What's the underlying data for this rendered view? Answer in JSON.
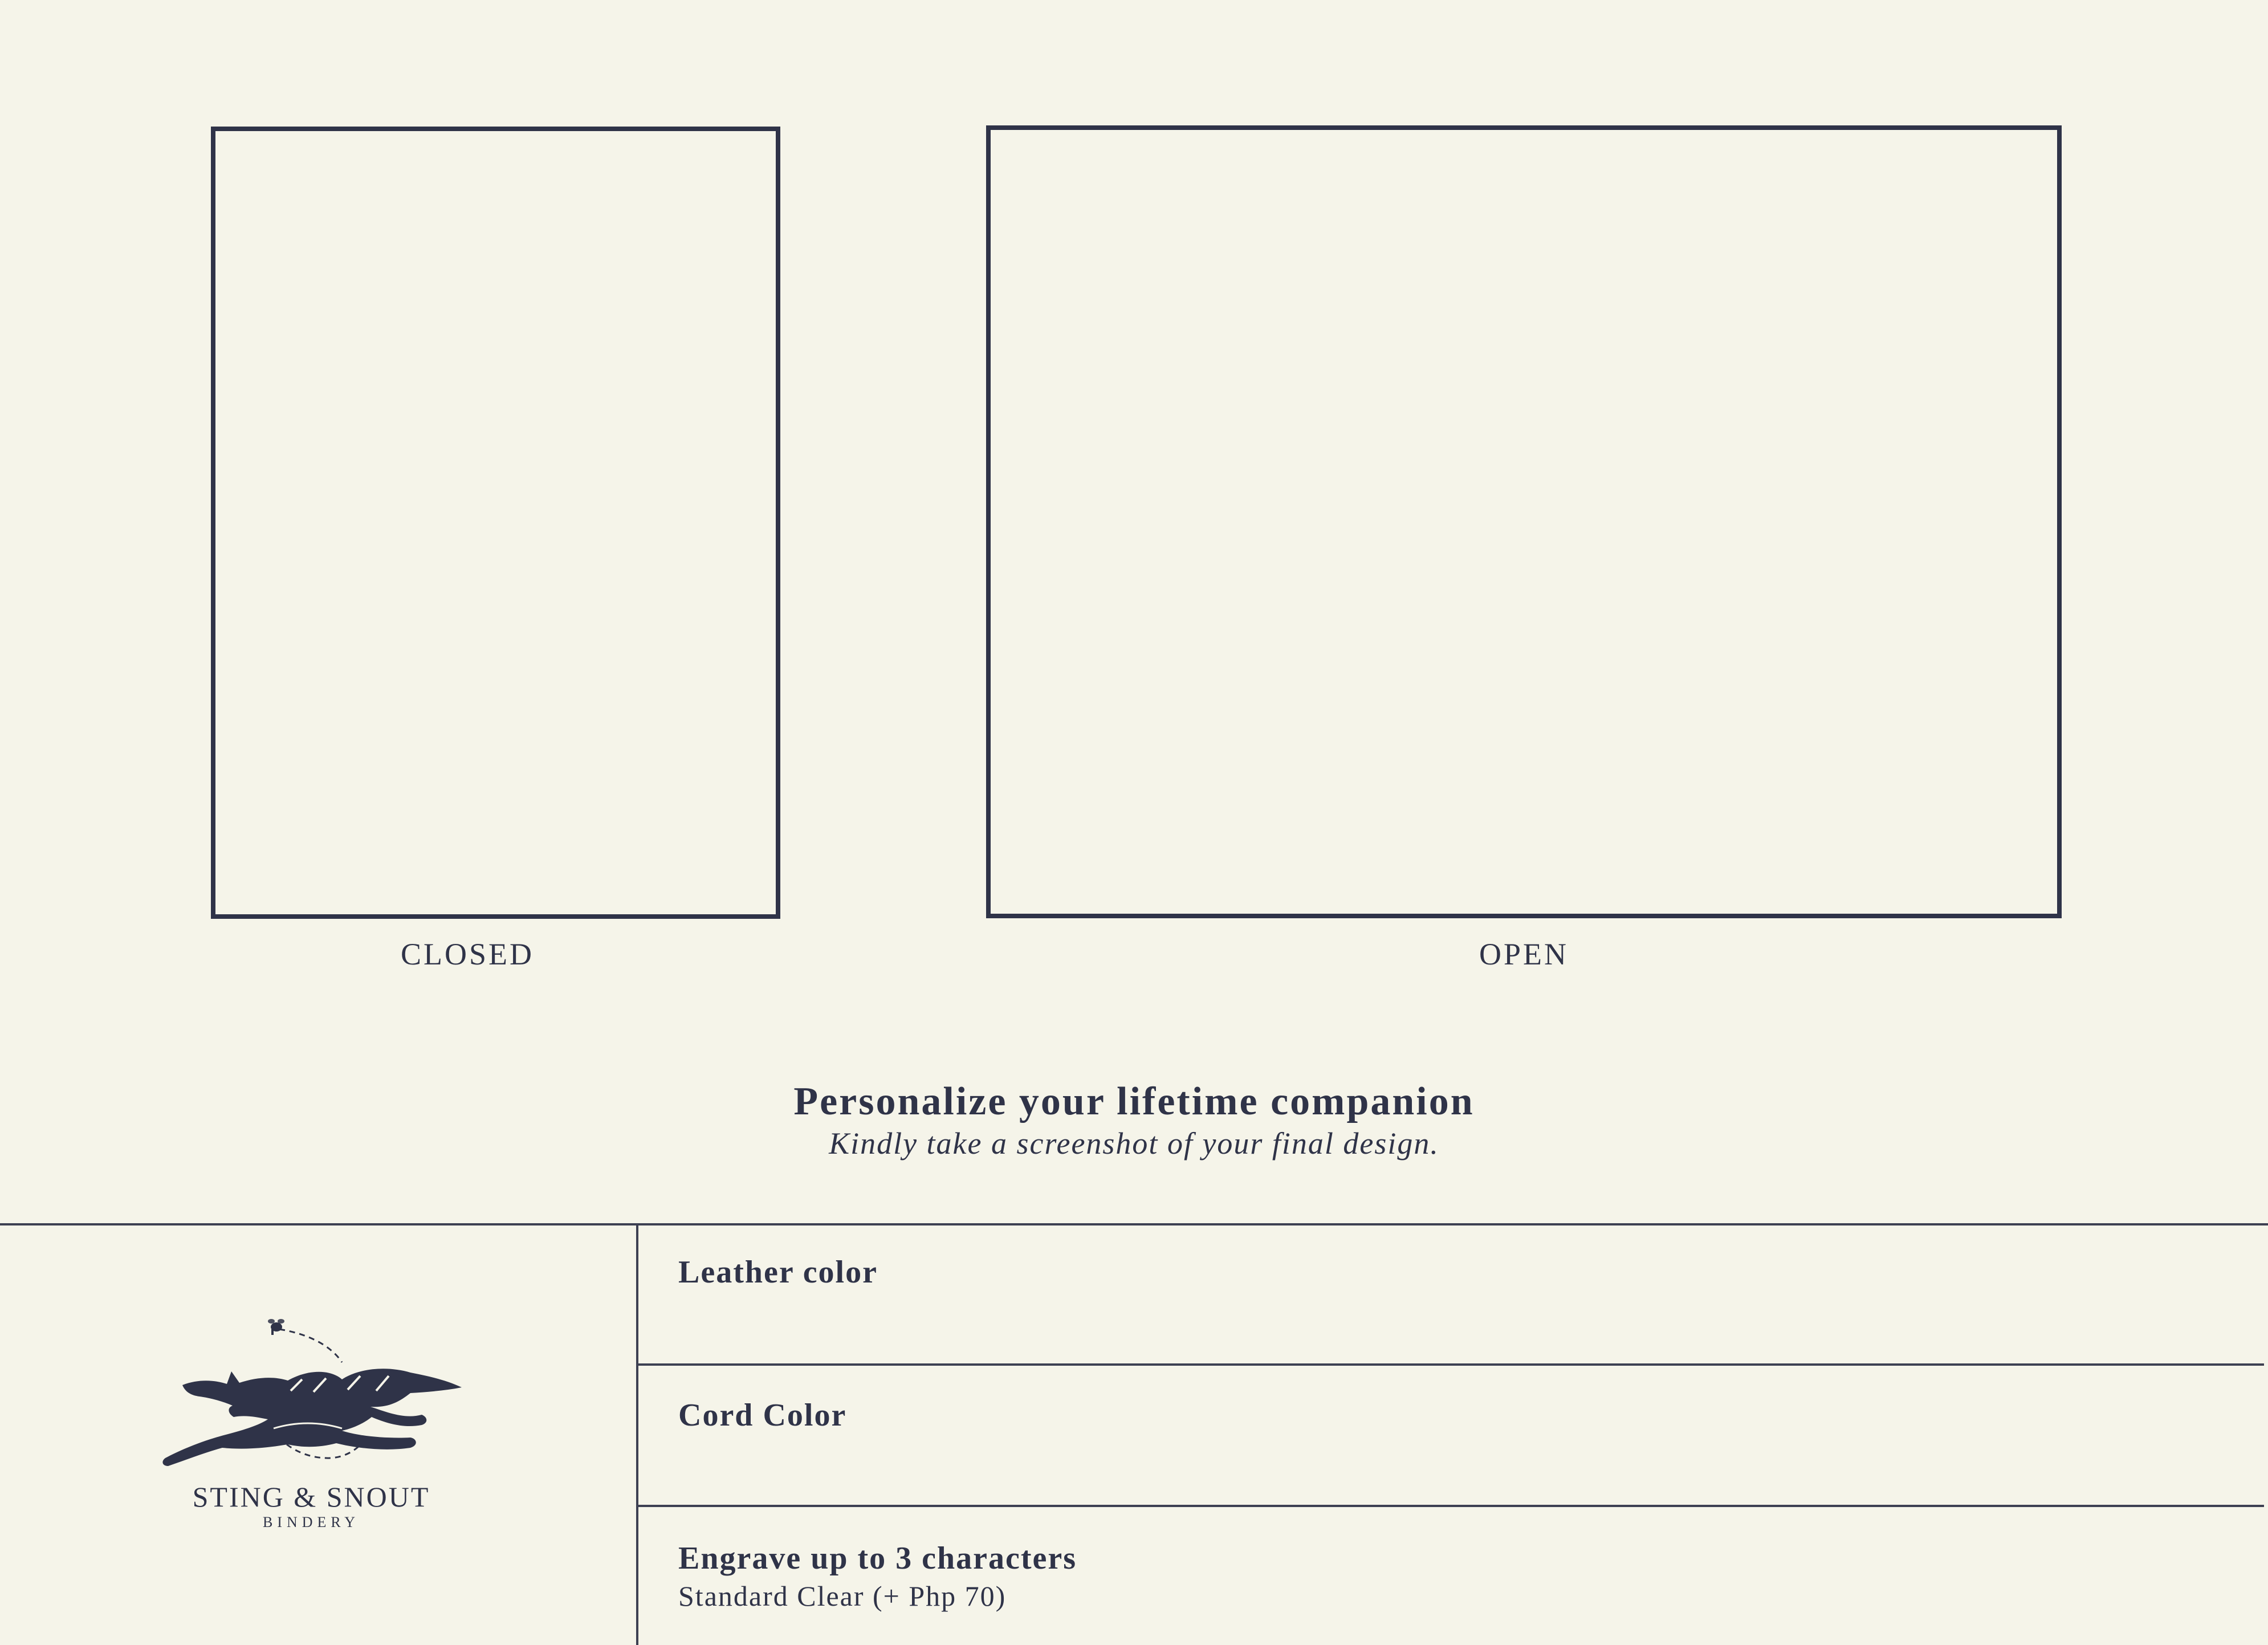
{
  "preview": {
    "closed_caption": "CLOSED",
    "open_caption": "OPEN"
  },
  "intro": {
    "heading": "Personalize your lifetime companion",
    "subheading": "Kindly take a screenshot of your final design."
  },
  "brand": {
    "name": "STING & SNOUT",
    "sub": "BINDERY",
    "logo_icon": "fox-and-bee-logo"
  },
  "options": {
    "leather_label": "Leather color",
    "cord_label": "Cord Color",
    "engrave_label": "Engrave up to 3 characters",
    "engrave_sub": "Standard Clear (+ Php 70)"
  },
  "colors": {
    "background": "#f5f4e9",
    "ink": "#2f3348"
  }
}
